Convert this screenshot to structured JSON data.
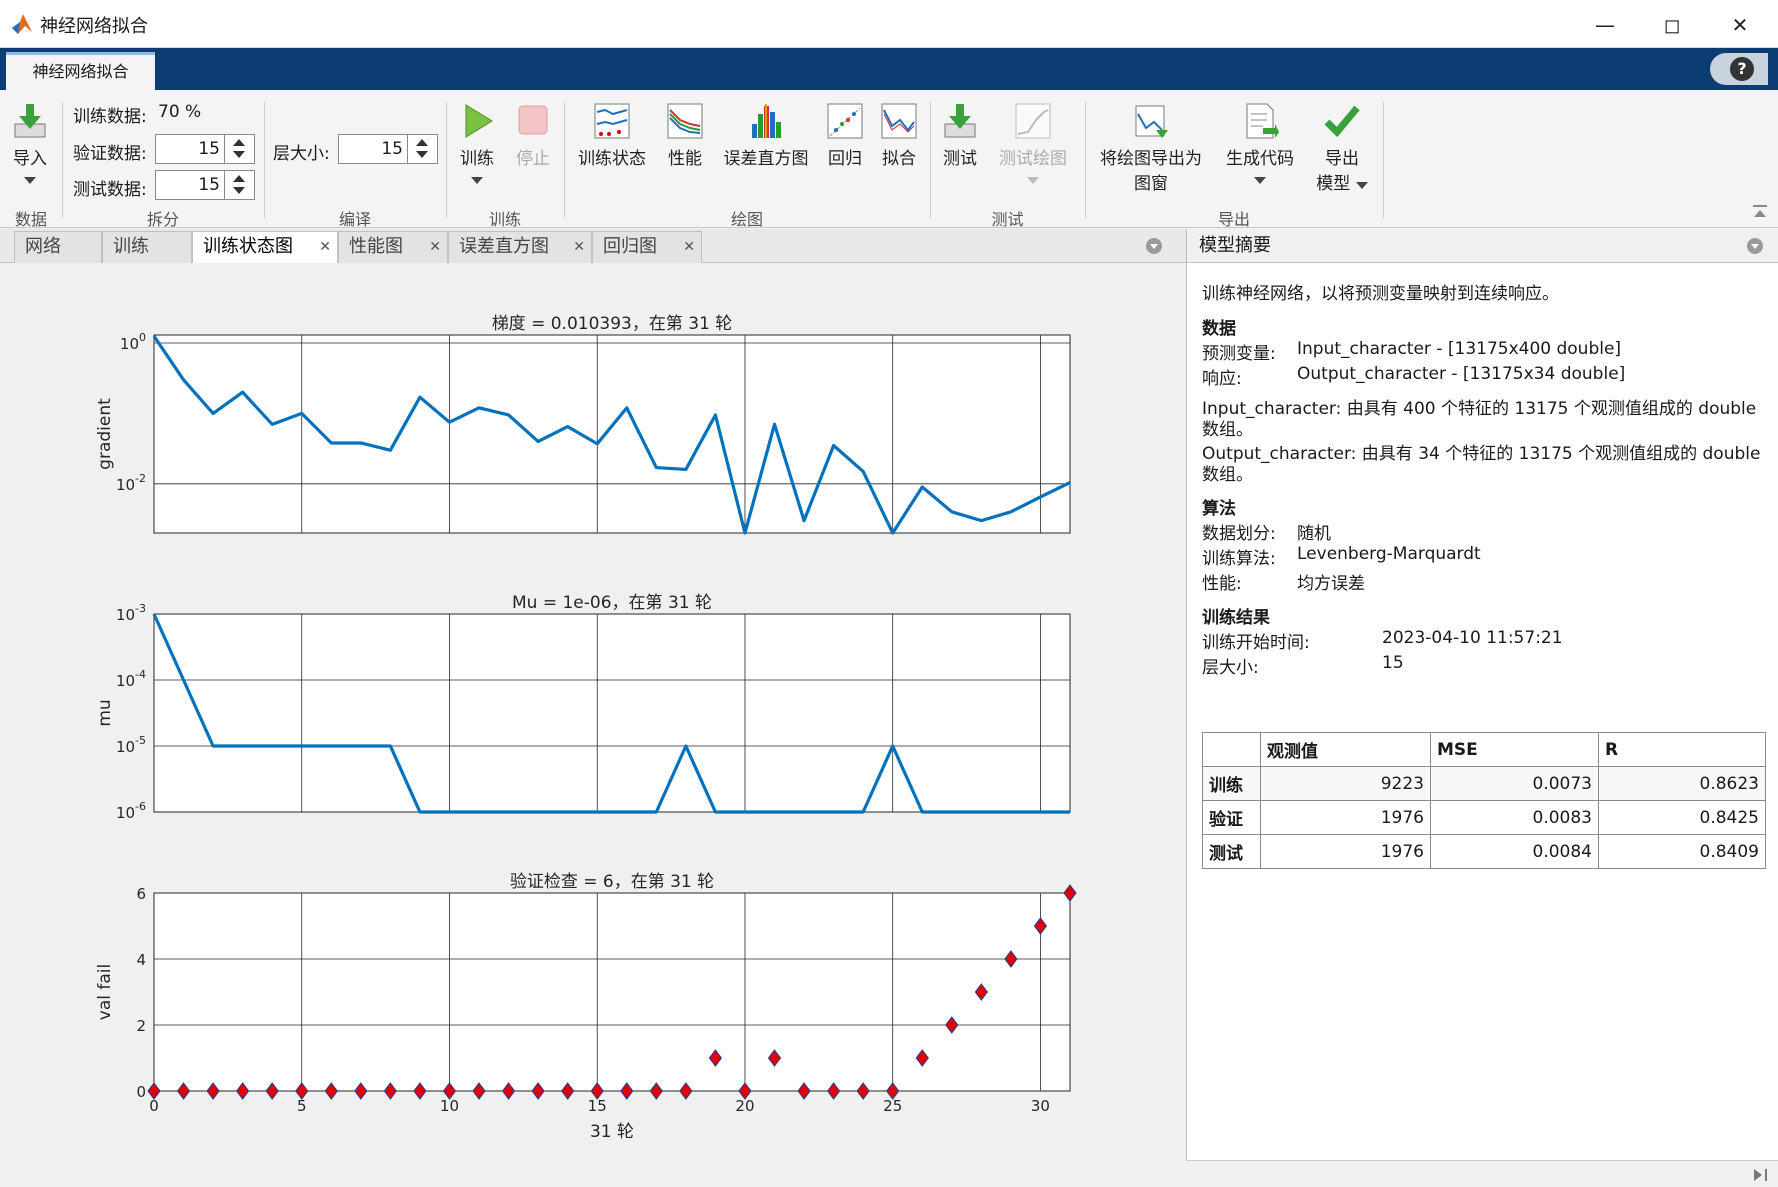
{
  "window": {
    "title": "神经网络拟合"
  },
  "app_tab": {
    "label": "神经网络拟合"
  },
  "toolstrip": {
    "import": {
      "label": "导入"
    },
    "train_data": {
      "label": "训练数据:",
      "value": "70 %"
    },
    "validation_data": {
      "label": "验证数据:",
      "value": "15"
    },
    "test_data": {
      "label": "测试数据:",
      "value": "15"
    },
    "layer_size": {
      "label": "层大小:",
      "value": "15"
    },
    "train": {
      "label": "训练"
    },
    "stop": {
      "label": "停止"
    },
    "plots": {
      "training_state": "训练状态",
      "performance": "性能",
      "error_histogram": "误差直方图",
      "regression": "回归",
      "fit": "拟合"
    },
    "test": {
      "label": "测试"
    },
    "test_plot": {
      "label": "测试绘图"
    },
    "export_plot": {
      "line1": "将绘图导出为",
      "line2": "图窗"
    },
    "generate_code": {
      "label": "生成代码"
    },
    "export_model": {
      "line1": "导出",
      "line2": "模型"
    },
    "sections": {
      "data": "数据",
      "split": "拆分",
      "compile": "编译",
      "train": "训练",
      "plot": "绘图",
      "test": "测试",
      "export": "导出"
    }
  },
  "doc_tabs": [
    {
      "label": "网络"
    },
    {
      "label": "训练"
    },
    {
      "label": "训练状态图"
    },
    {
      "label": "性能图"
    },
    {
      "label": "误差直方图"
    },
    {
      "label": "回归图"
    }
  ],
  "model_summary": {
    "header": "模型摘要",
    "intro": "训练神经网络，以将预测变量映射到连续响应。",
    "data_heading": "数据",
    "predictors_label": "预测变量:",
    "predictors_value": "Input_character - [13175x400 double]",
    "response_label": "响应:",
    "response_value": "Output_character - [13175x34 double]",
    "input_desc_1": "Input_character: 由具有 400 个特征的 13175 个观测值组成的 double",
    "input_desc_2": "数组。",
    "output_desc_1": "Output_character: 由具有 34 个特征的 13175 个观测值组成的 double",
    "output_desc_2": "数组。",
    "algorithm_heading": "算法",
    "split_label": "数据划分:",
    "split_value": "随机",
    "train_algo_label": "训练算法:",
    "train_algo_value": "Levenberg-Marquardt",
    "perf_label": "性能:",
    "perf_value": "均方误差",
    "results_heading": "训练结果",
    "start_time_label": "训练开始时间:",
    "start_time_value": "2023-04-10 11:57:21",
    "layer_size_label": "层大小:",
    "layer_size_value": "15",
    "table": {
      "headers": [
        "",
        "观测值",
        "MSE",
        "R"
      ],
      "rows": [
        [
          "训练",
          "9223",
          "0.0073",
          "0.8623"
        ],
        [
          "验证",
          "1976",
          "0.0083",
          "0.8425"
        ],
        [
          "测试",
          "1976",
          "0.0084",
          "0.8409"
        ]
      ]
    }
  },
  "chart_data": [
    {
      "type": "line",
      "title": "梯度 = 0.010393，在第 31 轮",
      "ylabel": "gradient",
      "yscale": "log",
      "ylim": [
        0.002,
        1.3
      ],
      "xlim": [
        0,
        31
      ],
      "yticks": [
        {
          "value": 1,
          "label": "10",
          "exp": "0"
        },
        {
          "value": 0.01,
          "label": "10",
          "exp": "-2"
        }
      ],
      "grid": true,
      "color": "#0072bd",
      "x": [
        0,
        1,
        2,
        3,
        4,
        5,
        6,
        7,
        8,
        9,
        10,
        11,
        12,
        13,
        14,
        15,
        16,
        17,
        18,
        19,
        20,
        21,
        22,
        23,
        24,
        25,
        26,
        27,
        28,
        29,
        30,
        31
      ],
      "values": [
        1.25,
        0.3,
        0.1,
        0.2,
        0.07,
        0.1,
        0.038,
        0.038,
        0.03,
        0.17,
        0.075,
        0.12,
        0.095,
        0.04,
        0.065,
        0.037,
        0.12,
        0.017,
        0.016,
        0.095,
        0.002,
        0.07,
        0.003,
        0.035,
        0.015,
        0.002,
        0.009,
        0.004,
        0.003,
        0.004,
        0.0065,
        0.010393
      ]
    },
    {
      "type": "line",
      "title": "Mu = 1e-06，在第 31 轮",
      "ylabel": "mu",
      "yscale": "log",
      "ylim": [
        1e-06,
        0.001
      ],
      "xlim": [
        0,
        31
      ],
      "yticks": [
        {
          "value": 0.001,
          "label": "10",
          "exp": "-3"
        },
        {
          "value": 0.0001,
          "label": "10",
          "exp": "-4"
        },
        {
          "value": 1e-05,
          "label": "10",
          "exp": "-5"
        },
        {
          "value": 1e-06,
          "label": "10",
          "exp": "-6"
        }
      ],
      "grid": true,
      "color": "#0072bd",
      "x": [
        0,
        1,
        2,
        3,
        4,
        5,
        6,
        7,
        8,
        9,
        10,
        11,
        12,
        13,
        14,
        15,
        16,
        17,
        18,
        19,
        20,
        21,
        22,
        23,
        24,
        25,
        26,
        27,
        28,
        29,
        30,
        31
      ],
      "values": [
        0.001,
        0.0001,
        1e-05,
        1e-05,
        1e-05,
        1e-05,
        1e-05,
        1e-05,
        1e-05,
        1e-06,
        1e-06,
        1e-06,
        1e-06,
        1e-06,
        1e-06,
        1e-06,
        1e-06,
        1e-06,
        1e-05,
        1e-06,
        1e-06,
        1e-06,
        1e-06,
        1e-06,
        1e-06,
        1e-05,
        1e-06,
        1e-06,
        1e-06,
        1e-06,
        1e-06,
        1e-06
      ]
    },
    {
      "type": "scatter",
      "title": "验证检查 = 6，在第 31 轮",
      "ylabel": "val fail",
      "xlabel": "31 轮",
      "ylim": [
        0,
        6
      ],
      "xlim": [
        0,
        31
      ],
      "yticks": [
        {
          "value": 0,
          "label": "0"
        },
        {
          "value": 2,
          "label": "2"
        },
        {
          "value": 4,
          "label": "4"
        },
        {
          "value": 6,
          "label": "6"
        }
      ],
      "xticks": [
        0,
        5,
        10,
        15,
        20,
        25,
        30
      ],
      "grid": true,
      "marker": "diamond",
      "marker_color": "#e00000",
      "marker_edge": "#1f3d99",
      "x": [
        0,
        1,
        2,
        3,
        4,
        5,
        6,
        7,
        8,
        9,
        10,
        11,
        12,
        13,
        14,
        15,
        16,
        17,
        18,
        19,
        20,
        21,
        22,
        23,
        24,
        25,
        26,
        27,
        28,
        29,
        30,
        31
      ],
      "values": [
        0,
        0,
        0,
        0,
        0,
        0,
        0,
        0,
        0,
        0,
        0,
        0,
        0,
        0,
        0,
        0,
        0,
        0,
        0,
        1,
        0,
        1,
        0,
        0,
        0,
        0,
        1,
        2,
        3,
        4,
        5,
        6
      ]
    }
  ]
}
